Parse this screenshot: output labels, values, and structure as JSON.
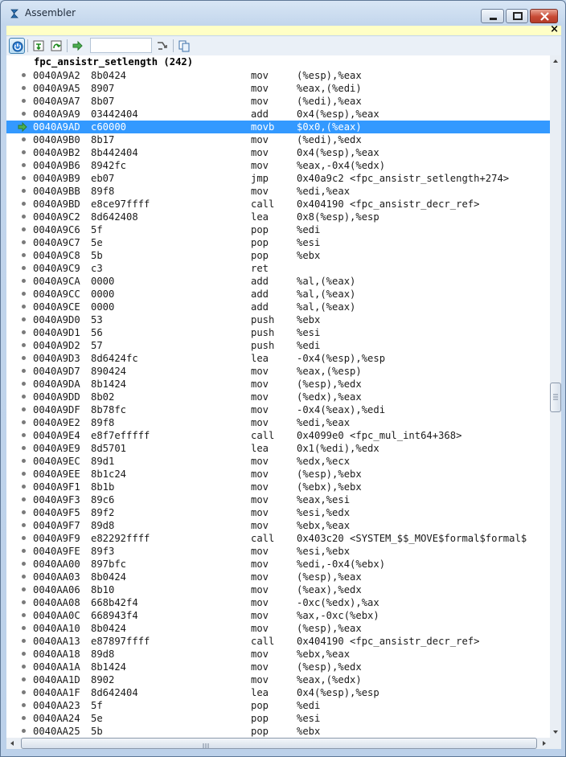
{
  "window": {
    "title": "Assembler"
  },
  "infobar": {
    "close_glyph": "×"
  },
  "toolbar": {
    "input_value": ""
  },
  "listing": {
    "header": "fpc_ansistr_setlength (242)",
    "current_row": 4,
    "rows": [
      {
        "addr": "0040A9A2",
        "bytes": "8b0424",
        "mn": "mov",
        "ops": "(%esp),%eax"
      },
      {
        "addr": "0040A9A5",
        "bytes": "8907",
        "mn": "mov",
        "ops": "%eax,(%edi)"
      },
      {
        "addr": "0040A9A7",
        "bytes": "8b07",
        "mn": "mov",
        "ops": "(%edi),%eax"
      },
      {
        "addr": "0040A9A9",
        "bytes": "03442404",
        "mn": "add",
        "ops": "0x4(%esp),%eax"
      },
      {
        "addr": "0040A9AD",
        "bytes": "c60000",
        "mn": "movb",
        "ops": "$0x0,(%eax)"
      },
      {
        "addr": "0040A9B0",
        "bytes": "8b17",
        "mn": "mov",
        "ops": "(%edi),%edx"
      },
      {
        "addr": "0040A9B2",
        "bytes": "8b442404",
        "mn": "mov",
        "ops": "0x4(%esp),%eax"
      },
      {
        "addr": "0040A9B6",
        "bytes": "8942fc",
        "mn": "mov",
        "ops": "%eax,-0x4(%edx)"
      },
      {
        "addr": "0040A9B9",
        "bytes": "eb07",
        "mn": "jmp",
        "ops": "0x40a9c2 <fpc_ansistr_setlength+274>"
      },
      {
        "addr": "0040A9BB",
        "bytes": "89f8",
        "mn": "mov",
        "ops": "%edi,%eax"
      },
      {
        "addr": "0040A9BD",
        "bytes": "e8ce97ffff",
        "mn": "call",
        "ops": "0x404190 <fpc_ansistr_decr_ref>"
      },
      {
        "addr": "0040A9C2",
        "bytes": "8d642408",
        "mn": "lea",
        "ops": "0x8(%esp),%esp"
      },
      {
        "addr": "0040A9C6",
        "bytes": "5f",
        "mn": "pop",
        "ops": "%edi"
      },
      {
        "addr": "0040A9C7",
        "bytes": "5e",
        "mn": "pop",
        "ops": "%esi"
      },
      {
        "addr": "0040A9C8",
        "bytes": "5b",
        "mn": "pop",
        "ops": "%ebx"
      },
      {
        "addr": "0040A9C9",
        "bytes": "c3",
        "mn": "ret",
        "ops": ""
      },
      {
        "addr": "0040A9CA",
        "bytes": "0000",
        "mn": "add",
        "ops": "%al,(%eax)"
      },
      {
        "addr": "0040A9CC",
        "bytes": "0000",
        "mn": "add",
        "ops": "%al,(%eax)"
      },
      {
        "addr": "0040A9CE",
        "bytes": "0000",
        "mn": "add",
        "ops": "%al,(%eax)"
      },
      {
        "addr": "0040A9D0",
        "bytes": "53",
        "mn": "push",
        "ops": "%ebx"
      },
      {
        "addr": "0040A9D1",
        "bytes": "56",
        "mn": "push",
        "ops": "%esi"
      },
      {
        "addr": "0040A9D2",
        "bytes": "57",
        "mn": "push",
        "ops": "%edi"
      },
      {
        "addr": "0040A9D3",
        "bytes": "8d6424fc",
        "mn": "lea",
        "ops": "-0x4(%esp),%esp"
      },
      {
        "addr": "0040A9D7",
        "bytes": "890424",
        "mn": "mov",
        "ops": "%eax,(%esp)"
      },
      {
        "addr": "0040A9DA",
        "bytes": "8b1424",
        "mn": "mov",
        "ops": "(%esp),%edx"
      },
      {
        "addr": "0040A9DD",
        "bytes": "8b02",
        "mn": "mov",
        "ops": "(%edx),%eax"
      },
      {
        "addr": "0040A9DF",
        "bytes": "8b78fc",
        "mn": "mov",
        "ops": "-0x4(%eax),%edi"
      },
      {
        "addr": "0040A9E2",
        "bytes": "89f8",
        "mn": "mov",
        "ops": "%edi,%eax"
      },
      {
        "addr": "0040A9E4",
        "bytes": "e8f7efffff",
        "mn": "call",
        "ops": "0x4099e0 <fpc_mul_int64+368>"
      },
      {
        "addr": "0040A9E9",
        "bytes": "8d5701",
        "mn": "lea",
        "ops": "0x1(%edi),%edx"
      },
      {
        "addr": "0040A9EC",
        "bytes": "89d1",
        "mn": "mov",
        "ops": "%edx,%ecx"
      },
      {
        "addr": "0040A9EE",
        "bytes": "8b1c24",
        "mn": "mov",
        "ops": "(%esp),%ebx"
      },
      {
        "addr": "0040A9F1",
        "bytes": "8b1b",
        "mn": "mov",
        "ops": "(%ebx),%ebx"
      },
      {
        "addr": "0040A9F3",
        "bytes": "89c6",
        "mn": "mov",
        "ops": "%eax,%esi"
      },
      {
        "addr": "0040A9F5",
        "bytes": "89f2",
        "mn": "mov",
        "ops": "%esi,%edx"
      },
      {
        "addr": "0040A9F7",
        "bytes": "89d8",
        "mn": "mov",
        "ops": "%ebx,%eax"
      },
      {
        "addr": "0040A9F9",
        "bytes": "e82292ffff",
        "mn": "call",
        "ops": "0x403c20 <SYSTEM_$$_MOVE$formal$formal$"
      },
      {
        "addr": "0040A9FE",
        "bytes": "89f3",
        "mn": "mov",
        "ops": "%esi,%ebx"
      },
      {
        "addr": "0040AA00",
        "bytes": "897bfc",
        "mn": "mov",
        "ops": "%edi,-0x4(%ebx)"
      },
      {
        "addr": "0040AA03",
        "bytes": "8b0424",
        "mn": "mov",
        "ops": "(%esp),%eax"
      },
      {
        "addr": "0040AA06",
        "bytes": "8b10",
        "mn": "mov",
        "ops": "(%eax),%edx"
      },
      {
        "addr": "0040AA08",
        "bytes": "668b42f4",
        "mn": "mov",
        "ops": "-0xc(%edx),%ax"
      },
      {
        "addr": "0040AA0C",
        "bytes": "668943f4",
        "mn": "mov",
        "ops": "%ax,-0xc(%ebx)"
      },
      {
        "addr": "0040AA10",
        "bytes": "8b0424",
        "mn": "mov",
        "ops": "(%esp),%eax"
      },
      {
        "addr": "0040AA13",
        "bytes": "e87897ffff",
        "mn": "call",
        "ops": "0x404190 <fpc_ansistr_decr_ref>"
      },
      {
        "addr": "0040AA18",
        "bytes": "89d8",
        "mn": "mov",
        "ops": "%ebx,%eax"
      },
      {
        "addr": "0040AA1A",
        "bytes": "8b1424",
        "mn": "mov",
        "ops": "(%esp),%edx"
      },
      {
        "addr": "0040AA1D",
        "bytes": "8902",
        "mn": "mov",
        "ops": "%eax,(%edx)"
      },
      {
        "addr": "0040AA1F",
        "bytes": "8d642404",
        "mn": "lea",
        "ops": "0x4(%esp),%esp"
      },
      {
        "addr": "0040AA23",
        "bytes": "5f",
        "mn": "pop",
        "ops": "%edi"
      },
      {
        "addr": "0040AA24",
        "bytes": "5e",
        "mn": "pop",
        "ops": "%esi"
      },
      {
        "addr": "0040AA25",
        "bytes": "5b",
        "mn": "pop",
        "ops": "%ebx"
      }
    ]
  }
}
